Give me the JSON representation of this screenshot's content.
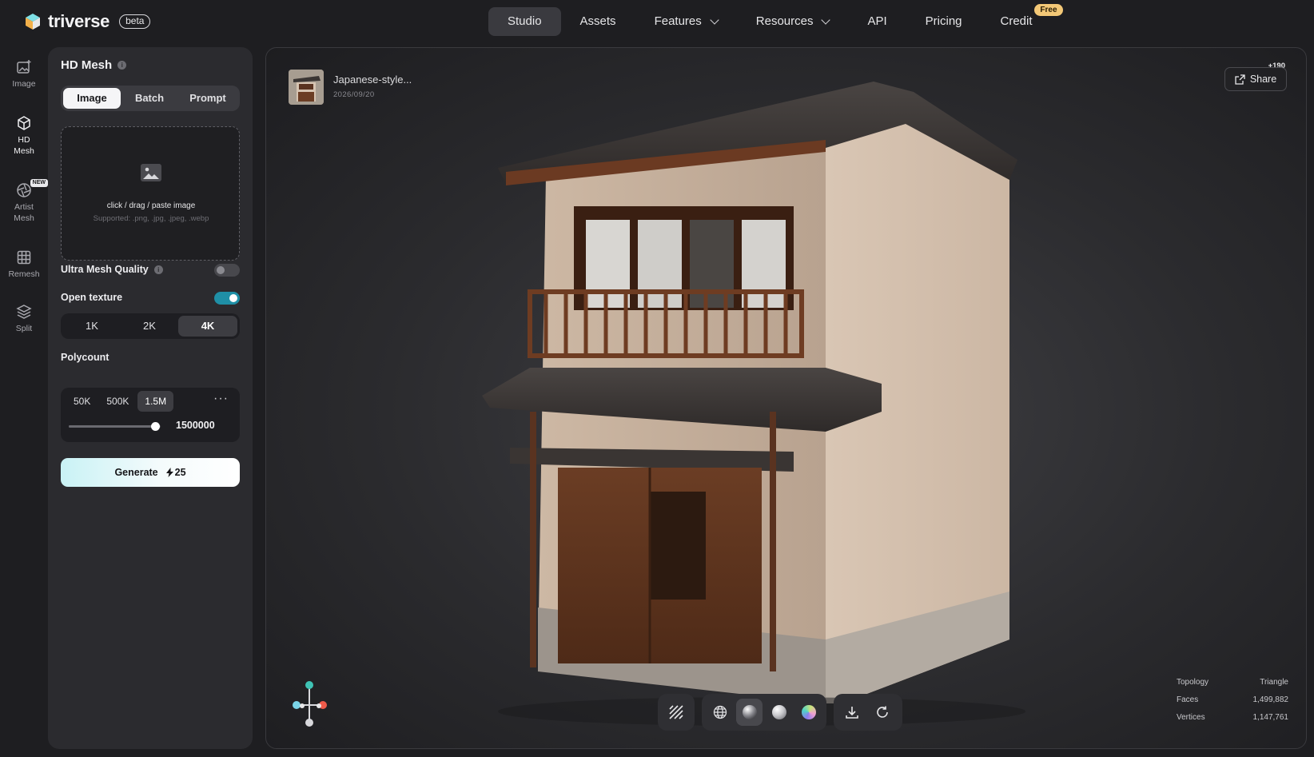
{
  "brand": {
    "name": "triverse",
    "badge": "beta"
  },
  "nav": {
    "items": [
      {
        "label": "Studio",
        "active": true
      },
      {
        "label": "Assets"
      },
      {
        "label": "Features",
        "dropdown": true
      },
      {
        "label": "Resources",
        "dropdown": true
      },
      {
        "label": "API"
      },
      {
        "label": "Pricing"
      },
      {
        "label": "Credit",
        "badge": "Free"
      }
    ]
  },
  "rail": {
    "items": [
      {
        "label": "Image",
        "icon": "image-plus-icon"
      },
      {
        "label": "HD Mesh",
        "icon": "cube-icon",
        "active": true
      },
      {
        "label": "Artist Mesh",
        "icon": "aperture-icon",
        "badge": "NEW"
      },
      {
        "label": "Remesh",
        "icon": "grid-icon"
      },
      {
        "label": "Split",
        "icon": "layers-icon"
      }
    ]
  },
  "panel": {
    "title": "HD Mesh",
    "info_glyph": "i",
    "input_modes": [
      "Image",
      "Batch",
      "Prompt"
    ],
    "active_mode": "Image",
    "dropzone": {
      "text": "click / drag / paste image",
      "supported": "Supported: .png, .jpg, .jpeg, .webp"
    },
    "ultra_quality": {
      "label": "Ultra Mesh Quality",
      "enabled": false
    },
    "open_texture": {
      "label": "Open texture",
      "enabled": true
    },
    "texture_res": {
      "options": [
        "1K",
        "2K",
        "4K"
      ],
      "selected": "4K"
    },
    "polycount": {
      "label": "Polycount",
      "options": [
        "50K",
        "500K",
        "1.5M"
      ],
      "selected": "1.5M",
      "more": "···",
      "value": "1500000",
      "slider_fraction": 0.94
    },
    "generate": {
      "label": "Generate",
      "cost": "25"
    }
  },
  "viewer": {
    "asset_name": "Japanese-style...",
    "asset_date": "2026/09/20",
    "share_label": "Share",
    "share_count": "+190",
    "stats": [
      {
        "label": "Topology",
        "value": "Triangle"
      },
      {
        "label": "Faces",
        "value": "1,499,882"
      },
      {
        "label": "Vertices",
        "value": "1,147,761"
      }
    ],
    "toolbar": {
      "wireframe": "hatch-icon",
      "modes": [
        "wire-globe-icon",
        "textured-sphere-icon",
        "clay-sphere-icon",
        "normal-sphere-icon"
      ],
      "active_mode": "textured-sphere-icon",
      "actions": [
        "download-icon",
        "rotate-icon"
      ]
    }
  },
  "colors": {
    "accent": "#1f8fa6",
    "badge_free": "#f3c877",
    "background": "#1e1e21",
    "panel": "#2b2b2f"
  }
}
